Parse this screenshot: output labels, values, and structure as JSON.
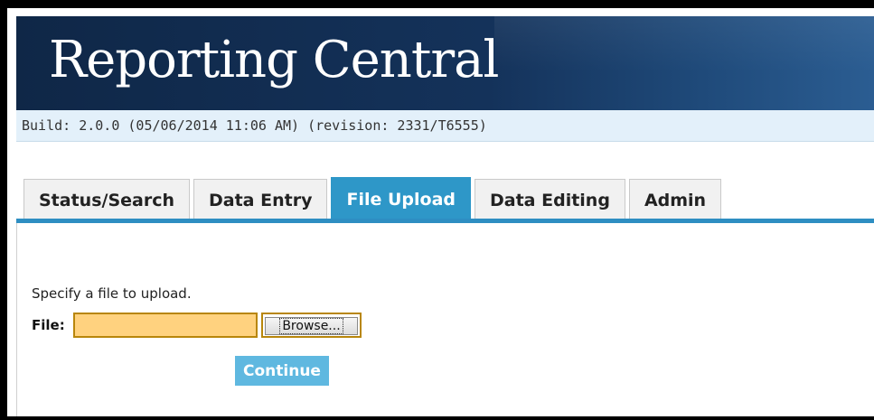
{
  "app": {
    "title": "Reporting Central",
    "build": "Build: 2.0.0 (05/06/2014 11:06 AM) (revision: 2331/T6555)"
  },
  "tabs": [
    {
      "label": "Status/Search",
      "active": false
    },
    {
      "label": "Data Entry",
      "active": false
    },
    {
      "label": "File Upload",
      "active": true
    },
    {
      "label": "Data Editing",
      "active": false
    },
    {
      "label": "Admin",
      "active": false
    }
  ],
  "upload": {
    "instruction": "Specify a file to upload.",
    "file_label": "File:",
    "file_value": "",
    "browse_label": "Browse...",
    "continue_label": "Continue"
  },
  "colors": {
    "banner": "#14325a",
    "tab_active": "#2e97c8",
    "file_input_bg": "#ffd27f",
    "continue_bg": "#5fb8e0"
  }
}
